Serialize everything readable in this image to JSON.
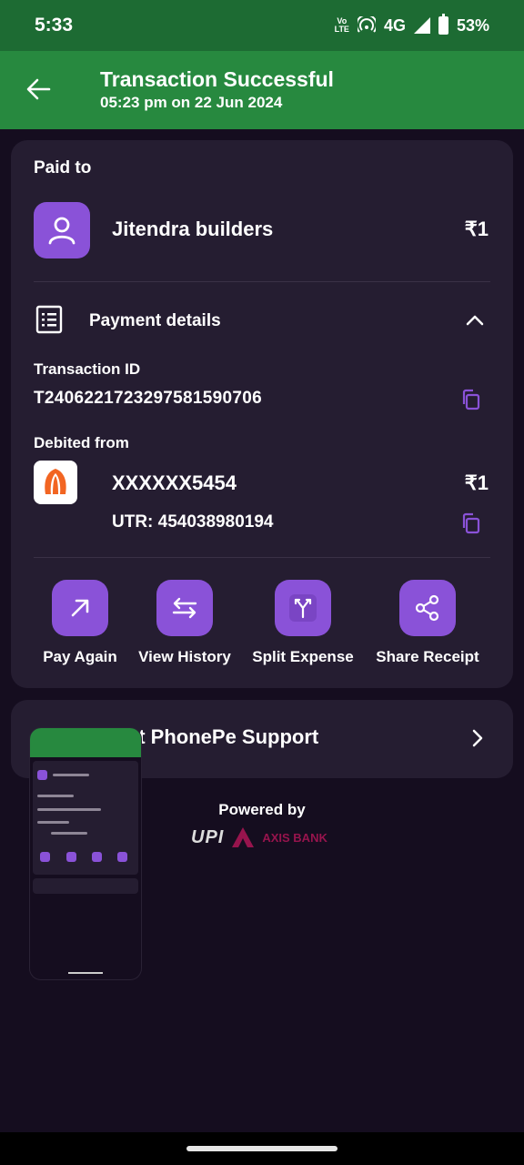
{
  "status_bar": {
    "time": "5:33",
    "volte_label": "Vo LTE",
    "network": "4G",
    "battery": "53%"
  },
  "header": {
    "title": "Transaction Successful",
    "subtitle": "05:23 pm on 22 Jun 2024"
  },
  "payee": {
    "section_label": "Paid to",
    "name": "Jitendra builders",
    "amount": "₹1"
  },
  "payment_details": {
    "title": "Payment details",
    "transaction_id_label": "Transaction ID",
    "transaction_id": "T2406221723297581590706",
    "debited_from_label": "Debited from",
    "account": "XXXXXX5454",
    "amount": "₹1",
    "utr": "UTR: 454038980194"
  },
  "actions": [
    {
      "label": "Pay Again",
      "icon": "arrow-up-right-icon"
    },
    {
      "label": "View History",
      "icon": "swap-arrows-icon"
    },
    {
      "label": "Split Expense",
      "icon": "split-icon"
    },
    {
      "label": "Share Receipt",
      "icon": "share-icon"
    }
  ],
  "support": {
    "label": "Contact PhonePe Support",
    "visible_label": "ntact PhonePe Support"
  },
  "footer": {
    "powered_by": "Powered by",
    "upi_logo": "UPI",
    "bank_logo": "AXIS BANK"
  },
  "colors": {
    "status_green": "#1d6b33",
    "header_green": "#27893f",
    "accent_purple": "#8a52d8",
    "card_bg": "#251d31",
    "page_bg": "#150d1f"
  }
}
